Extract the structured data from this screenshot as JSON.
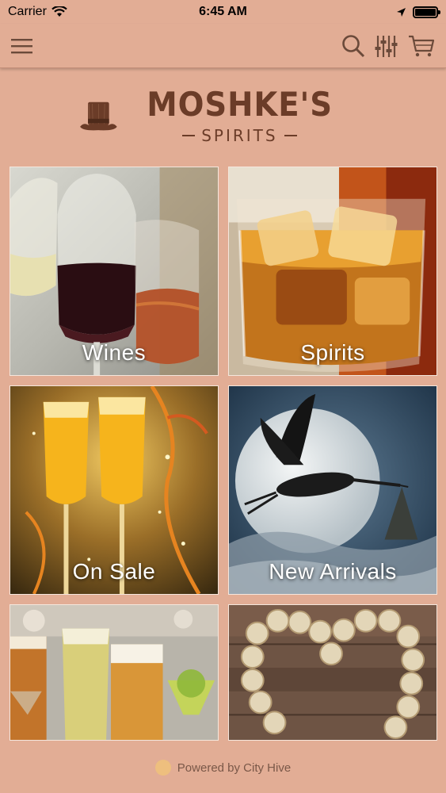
{
  "status_bar": {
    "carrier": "Carrier",
    "time": "6:45 AM",
    "battery_level": 1.0
  },
  "nav": {
    "menu_icon": "hamburger-menu-icon",
    "search_icon": "search-icon",
    "filter_icon": "filter-sliders-icon",
    "cart_icon": "shopping-cart-icon"
  },
  "logo": {
    "title": "MOSHKE'S",
    "subtitle": "SPIRITS",
    "icon": "top-hat-icon"
  },
  "categories": [
    {
      "label": "Wines"
    },
    {
      "label": "Spirits"
    },
    {
      "label": "On Sale"
    },
    {
      "label": "New Arrivals"
    },
    {
      "label": ""
    },
    {
      "label": ""
    }
  ],
  "footer": {
    "text": "Powered by City Hive",
    "icon": "city-hive-logo-icon"
  },
  "colors": {
    "background": "#e2ad95",
    "brand_brown": "#6b3c28"
  }
}
